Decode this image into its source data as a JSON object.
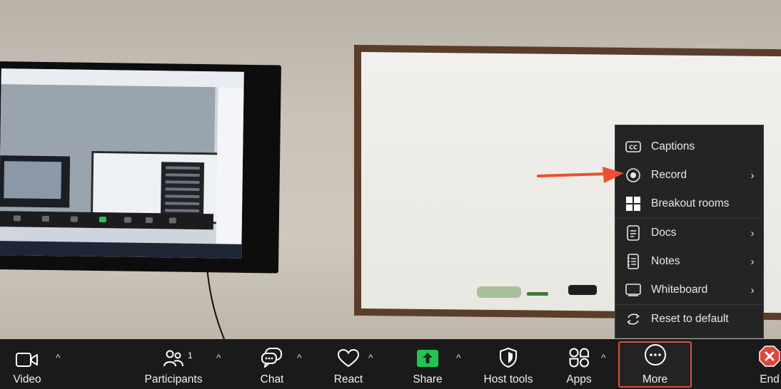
{
  "more_menu": {
    "items": [
      {
        "label": "Captions",
        "icon": "captions-icon",
        "submenu": false
      },
      {
        "label": "Record",
        "icon": "record-icon",
        "submenu": true
      },
      {
        "label": "Breakout rooms",
        "icon": "breakout-rooms-icon",
        "submenu": false
      },
      {
        "label": "Docs",
        "icon": "docs-icon",
        "submenu": true
      },
      {
        "label": "Notes",
        "icon": "notes-icon",
        "submenu": true
      },
      {
        "label": "Whiteboard",
        "icon": "whiteboard-icon",
        "submenu": true
      },
      {
        "label": "Reset to default",
        "icon": "reset-icon",
        "submenu": false
      }
    ],
    "chevron": "›"
  },
  "toolbar": {
    "video": "Video",
    "participants": "Participants",
    "participants_count": "1",
    "chat": "Chat",
    "react": "React",
    "share": "Share",
    "host_tools": "Host tools",
    "apps": "Apps",
    "more": "More",
    "end": "End",
    "caret": "^"
  },
  "colors": {
    "toolbar_bg": "#1a1a1a",
    "menu_bg": "#242424",
    "share_green": "#23c552",
    "end_red": "#e0463d",
    "highlight_border": "#d9533d",
    "annotation_arrow": "#ea4f2f"
  }
}
